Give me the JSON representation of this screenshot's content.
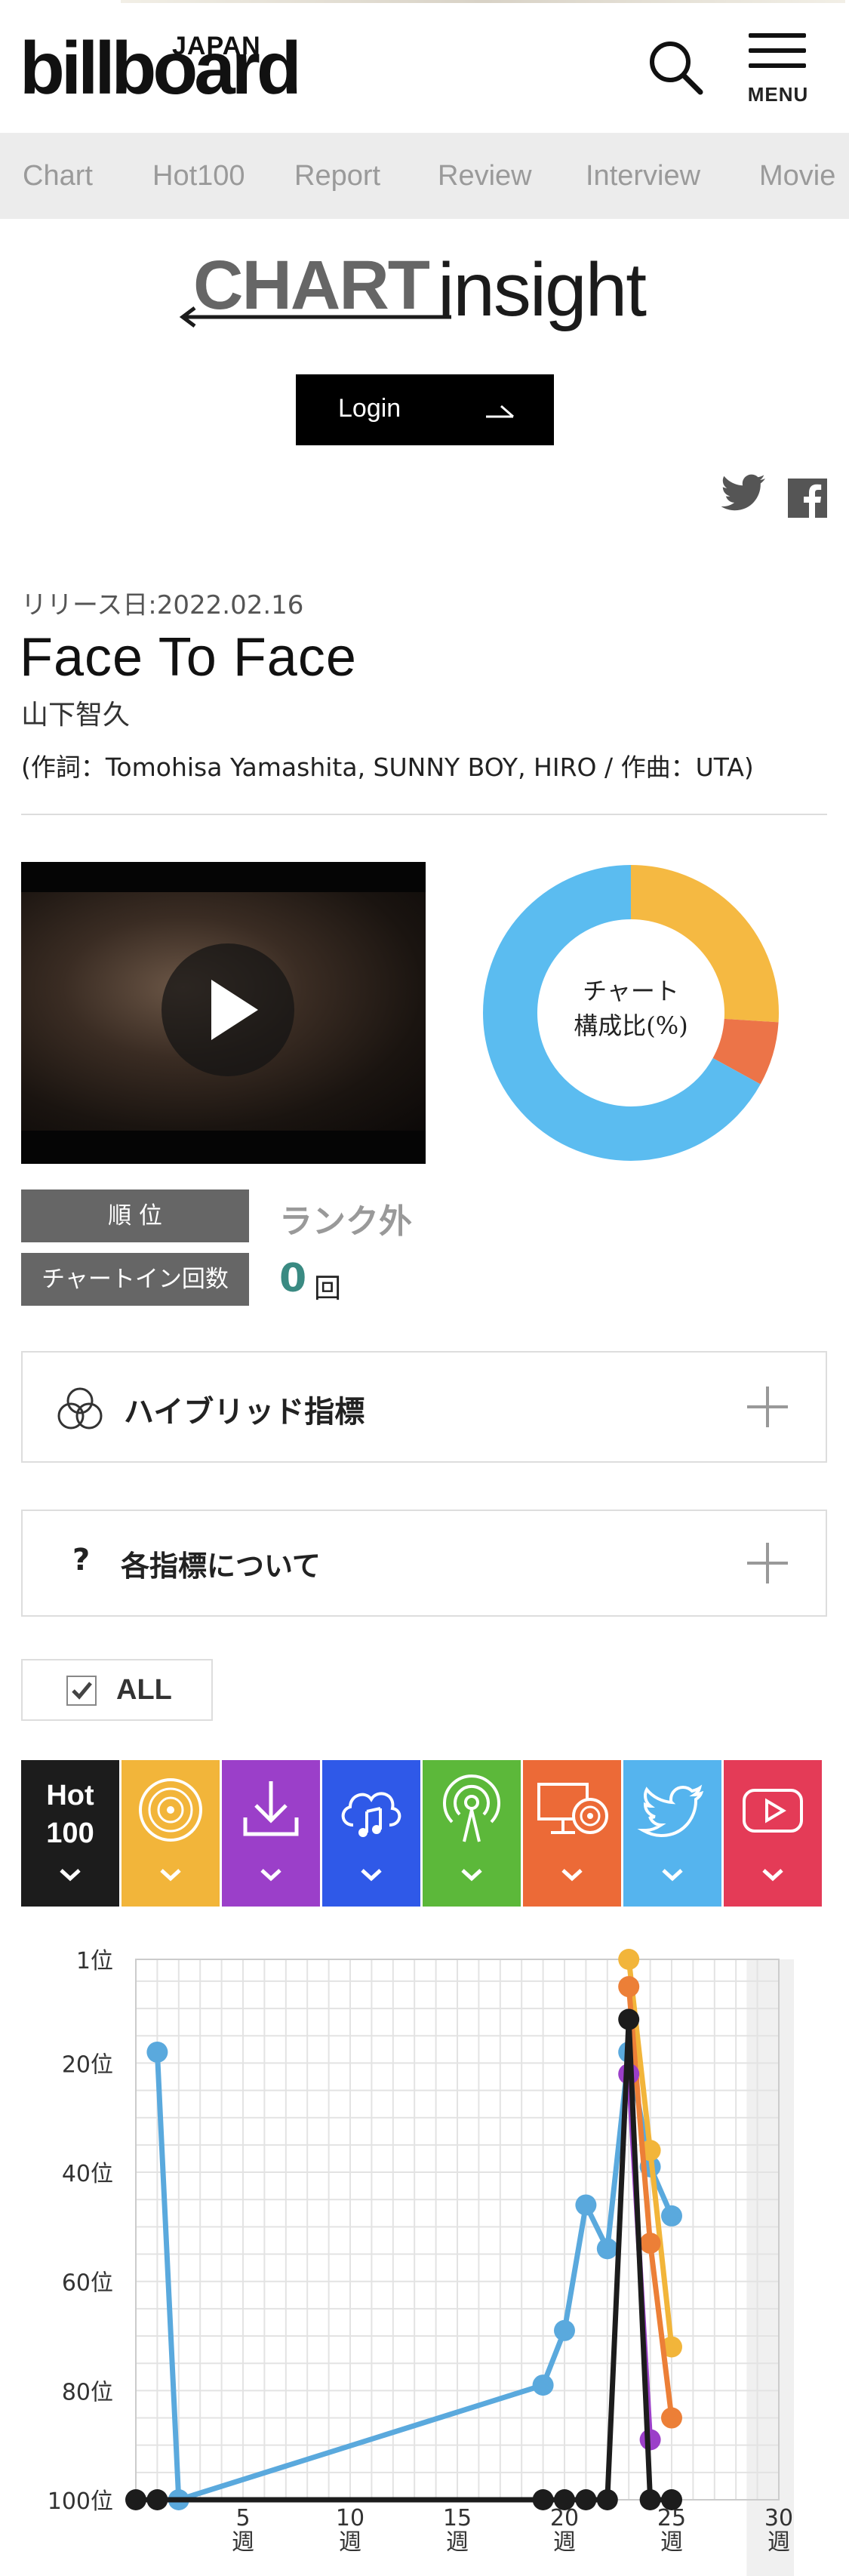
{
  "header": {
    "logo_small": "JAPAN",
    "logo_main": "billboard",
    "search_icon": "search-icon",
    "menu_label": "MENU"
  },
  "nav": {
    "items": [
      "Chart",
      "Hot100",
      "Report",
      "Review",
      "Interview",
      "Movie"
    ]
  },
  "insight_logo": {
    "chart": "CHART",
    "insight": "insight"
  },
  "login": {
    "label": "Login"
  },
  "share": {
    "twitter_icon": "twitter-icon",
    "facebook_icon": "facebook-icon"
  },
  "song": {
    "release": "リリース日:2022.02.16",
    "title": "Face To Face",
    "artist": "山下智久",
    "credits": "(作詞：Tomohisa Yamashita, SUNNY BOY, HIRO / 作曲：UTA)"
  },
  "composition": {
    "label_line1": "チャート",
    "label_line2": "構成比(%)",
    "segments": [
      {
        "color": "#f5b942",
        "percent": 26
      },
      {
        "color": "#ec7448",
        "percent": 7
      },
      {
        "color": "#5bbcf0",
        "percent": 67
      }
    ]
  },
  "rank": {
    "label": "順 位",
    "value": "ランク外"
  },
  "chart_in": {
    "label": "チャートイン回数",
    "count": "0",
    "unit": "回"
  },
  "accordions": {
    "hybrid": "ハイブリッド指標",
    "about": "各指標について",
    "about_icon": "?"
  },
  "filter": {
    "all_label": "ALL"
  },
  "tabs": [
    {
      "id": "hot100",
      "line1": "Hot",
      "line2": "100",
      "color": "#1c1c1c",
      "icon": "hot100-label"
    },
    {
      "id": "sales",
      "color": "#f2b53a",
      "icon": "cd-icon"
    },
    {
      "id": "download",
      "color": "#9b3fc9",
      "icon": "download-icon"
    },
    {
      "id": "streaming",
      "color": "#2f59e8",
      "icon": "cloud-music-icon"
    },
    {
      "id": "radio",
      "color": "#5cb83a",
      "icon": "radio-icon"
    },
    {
      "id": "lookup",
      "color": "#ec6a37",
      "icon": "pc-cd-icon"
    },
    {
      "id": "twitter",
      "color": "#55b4ee",
      "icon": "twitter-icon"
    },
    {
      "id": "video",
      "color": "#e43b57",
      "icon": "play-icon"
    }
  ],
  "chart_data": {
    "type": "line",
    "y_labels": [
      "1位",
      "20位",
      "40位",
      "60位",
      "80位",
      "100位"
    ],
    "x_labels": [
      "5\n週",
      "10\n週",
      "15\n週",
      "20\n週",
      "25\n週",
      "30\n週"
    ],
    "ylim": [
      100,
      1
    ],
    "xlim": [
      0,
      30
    ],
    "series": [
      {
        "color": "#5aa9dd",
        "points": [
          [
            1,
            18
          ],
          [
            2,
            100
          ],
          [
            19,
            79
          ],
          [
            20,
            69
          ],
          [
            21,
            46
          ],
          [
            22,
            54
          ],
          [
            23,
            18
          ],
          [
            24,
            39
          ],
          [
            25,
            48
          ]
        ]
      },
      {
        "color": "#f2b53a",
        "points": [
          [
            23,
            1
          ],
          [
            24,
            36
          ],
          [
            25,
            72
          ]
        ]
      },
      {
        "color": "#ec7f37",
        "points": [
          [
            23,
            6
          ],
          [
            24,
            53
          ],
          [
            25,
            85
          ]
        ]
      },
      {
        "color": "#9b3fc9",
        "points": [
          [
            23,
            22
          ],
          [
            24,
            89
          ]
        ]
      },
      {
        "color": "#1c1c1c",
        "points": [
          [
            0,
            100
          ],
          [
            1,
            100
          ],
          [
            19,
            100
          ],
          [
            20,
            100
          ],
          [
            21,
            100
          ],
          [
            22,
            100
          ],
          [
            23,
            12
          ],
          [
            24,
            100
          ],
          [
            25,
            100
          ]
        ]
      }
    ]
  }
}
